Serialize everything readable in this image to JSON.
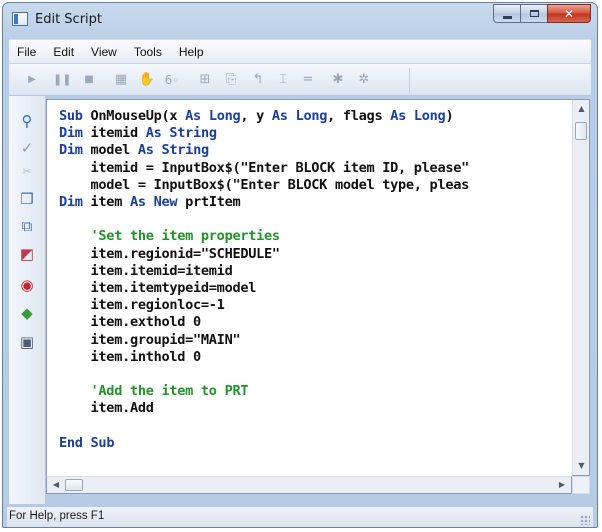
{
  "window": {
    "title": "Edit Script",
    "close_glyph": "✕"
  },
  "menu": {
    "items": [
      "File",
      "Edit",
      "View",
      "Tools",
      "Help"
    ]
  },
  "toolbar": {
    "icons": [
      "play-icon",
      "pause-icon",
      "stop-icon",
      "calendar-icon",
      "hand-icon",
      "watch-icon",
      "step-icon",
      "step-over-icon",
      "step-out-icon",
      "indent-icon",
      "equals-icon",
      "breakpoint-icon",
      "clear-breakpoint-icon"
    ]
  },
  "editor": {
    "lines": [
      {
        "parts": [
          {
            "t": "Sub",
            "c": "kw"
          },
          {
            "t": " OnMouseUp(x ",
            "c": ""
          },
          {
            "t": "As",
            "c": "kw"
          },
          {
            "t": " ",
            "c": ""
          },
          {
            "t": "Long",
            "c": "kw"
          },
          {
            "t": ", y ",
            "c": ""
          },
          {
            "t": "As",
            "c": "kw"
          },
          {
            "t": " ",
            "c": ""
          },
          {
            "t": "Long",
            "c": "kw"
          },
          {
            "t": ", flags ",
            "c": ""
          },
          {
            "t": "As",
            "c": "kw"
          },
          {
            "t": " ",
            "c": ""
          },
          {
            "t": "Long",
            "c": "kw"
          },
          {
            "t": ")",
            "c": ""
          }
        ]
      },
      {
        "parts": [
          {
            "t": "Dim",
            "c": "kw"
          },
          {
            "t": " itemid ",
            "c": ""
          },
          {
            "t": "As",
            "c": "kw"
          },
          {
            "t": " ",
            "c": ""
          },
          {
            "t": "String",
            "c": "kw"
          }
        ]
      },
      {
        "parts": [
          {
            "t": "Dim",
            "c": "kw"
          },
          {
            "t": " model ",
            "c": ""
          },
          {
            "t": "As",
            "c": "kw"
          },
          {
            "t": " ",
            "c": ""
          },
          {
            "t": "String",
            "c": "kw"
          }
        ]
      },
      {
        "parts": [
          {
            "t": "    itemid = InputBox$(\"Enter BLOCK item ID, please\"",
            "c": ""
          }
        ]
      },
      {
        "parts": [
          {
            "t": "    model = InputBox$(\"Enter BLOCK model type, pleas",
            "c": ""
          }
        ]
      },
      {
        "parts": [
          {
            "t": "Dim",
            "c": "kw"
          },
          {
            "t": " item ",
            "c": ""
          },
          {
            "t": "As",
            "c": "kw"
          },
          {
            "t": " ",
            "c": ""
          },
          {
            "t": "New",
            "c": "kw"
          },
          {
            "t": " prtItem",
            "c": ""
          }
        ]
      },
      {
        "parts": []
      },
      {
        "parts": [
          {
            "t": "    'Set the item properties",
            "c": "cm"
          }
        ]
      },
      {
        "parts": [
          {
            "t": "    item.regionid=\"SCHEDULE\"",
            "c": ""
          }
        ]
      },
      {
        "parts": [
          {
            "t": "    item.itemid=itemid",
            "c": ""
          }
        ]
      },
      {
        "parts": [
          {
            "t": "    item.itemtypeid=model",
            "c": ""
          }
        ]
      },
      {
        "parts": [
          {
            "t": "    item.regionloc=-1",
            "c": ""
          }
        ]
      },
      {
        "parts": [
          {
            "t": "    item.exthold 0",
            "c": ""
          }
        ]
      },
      {
        "parts": [
          {
            "t": "    item.groupid=\"MAIN\"",
            "c": ""
          }
        ]
      },
      {
        "parts": [
          {
            "t": "    item.inthold 0",
            "c": ""
          }
        ]
      },
      {
        "parts": []
      },
      {
        "parts": [
          {
            "t": "    'Add the item to PRT",
            "c": "cm"
          }
        ]
      },
      {
        "parts": [
          {
            "t": "    item.Add",
            "c": ""
          }
        ]
      },
      {
        "parts": []
      },
      {
        "parts": [
          {
            "t": "End",
            "c": "kw"
          },
          {
            "t": " ",
            "c": ""
          },
          {
            "t": "Sub",
            "c": "kw"
          }
        ]
      }
    ]
  },
  "status": {
    "text": "For Help, press F1"
  },
  "colors": {
    "keyword": "#1c3f9c",
    "comment": "#23922b",
    "text": "#111111"
  }
}
